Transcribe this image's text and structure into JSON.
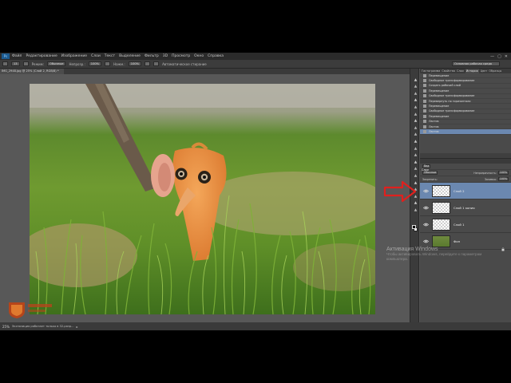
{
  "menubar": {
    "app_icon": "Ps",
    "items": [
      "Файл",
      "Редактирование",
      "Изображение",
      "Слои",
      "Текст",
      "Выделение",
      "Фильтр",
      "3D",
      "Просмотр",
      "Окно",
      "Справка"
    ],
    "window_controls": [
      "—",
      "▢",
      "✕"
    ]
  },
  "options_bar": {
    "brush_size": "13",
    "mode_label": "Режим:",
    "mode_value": "Обычные",
    "opacity_label": "Непрозр.:",
    "opacity_value": "100%",
    "pressure_label": "Нажм.:",
    "pressure_value": "100%",
    "extra_option": "Автоматическое стирание",
    "workspace": "Основная рабочая среда"
  },
  "document_tab": {
    "label": "IMG_2948.jpg @ 25% (Слой 2, RGB/8) *"
  },
  "status_bar": {
    "zoom": "25%",
    "info": "Экспозиция работает только в 32-разр...",
    "arrow": "▸"
  },
  "tools": [
    "move",
    "marquee",
    "lasso",
    "quick-select",
    "crop",
    "eyedropper",
    "healing",
    "brush",
    "stamp",
    "history-brush",
    "eraser",
    "gradient",
    "blur",
    "dodge",
    "pen",
    "type",
    "path-select",
    "shape",
    "hand",
    "zoom"
  ],
  "history_panel": {
    "tabs": [
      "Гистограмма",
      "Свойства",
      "Слои",
      "История",
      "Цвет",
      "Образцы"
    ],
    "active_tab": "История",
    "items": [
      "Перемещение",
      "Свободное трансформирование",
      "Создать рабочий слой",
      "Перемещение",
      "Свободное трансформирование",
      "Перевернуть по горизонтали",
      "Перемещение",
      "Свободное трансформирование",
      "Перемещение",
      "Ластик",
      "Ластик",
      "Ластик"
    ],
    "active_index": 11
  },
  "layers_panel": {
    "tab": "Слои",
    "filter_type": "Вид",
    "blend_mode": "Обычные",
    "opacity_label": "Непрозрачность:",
    "opacity_value": "100%",
    "lock_label": "Закрепить:",
    "fill_label": "Заливка:",
    "fill_value": "100%",
    "layers": [
      {
        "name": "Слой 2",
        "active": true,
        "thumb": "transparent"
      },
      {
        "name": "Слой 1 копия",
        "active": false,
        "thumb": "transparent"
      },
      {
        "name": "Слой 1",
        "active": false,
        "thumb": "transparent"
      },
      {
        "name": "Фон",
        "active": false,
        "thumb": "photo",
        "locked": true
      }
    ]
  },
  "watermark": {
    "title": "Активация Windows",
    "text": "Чтобы активировать Windows, перейдите к параметрам компьютера."
  },
  "colors": {
    "ui_background": "#535353",
    "panel": "#4a4a4a",
    "selection": "#6b88b0",
    "annotation_arrow": "#e0201e"
  }
}
